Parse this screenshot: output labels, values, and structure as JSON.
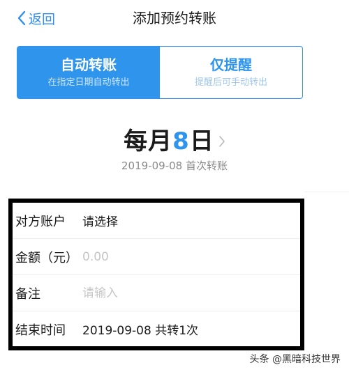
{
  "header": {
    "back_label": "返回",
    "title": "添加预约转账"
  },
  "mode_switch": {
    "auto": {
      "title": "自动转账",
      "subtitle": "在指定日期自动转出"
    },
    "remind": {
      "title": "仅提醒",
      "subtitle": "提醒后可手动转出"
    },
    "selected": "auto"
  },
  "schedule": {
    "prefix": "每月",
    "day": "8",
    "suffix": "日",
    "first_transfer": "2019-09-08 首次转账"
  },
  "form": {
    "account": {
      "label": "对方账户",
      "value": "请选择"
    },
    "amount": {
      "label": "金额（元）",
      "placeholder": "0.00"
    },
    "note": {
      "label": "备注",
      "placeholder": "请输入"
    },
    "end_time": {
      "label": "结束时间",
      "value": "2019-09-08 共转1次"
    }
  },
  "watermark": "头条 @黑暗科技世界",
  "colors": {
    "accent": "#2f94ec",
    "frame": "#000000",
    "placeholder": "#c6c6c6",
    "secondary_text": "#8a8a8a"
  }
}
